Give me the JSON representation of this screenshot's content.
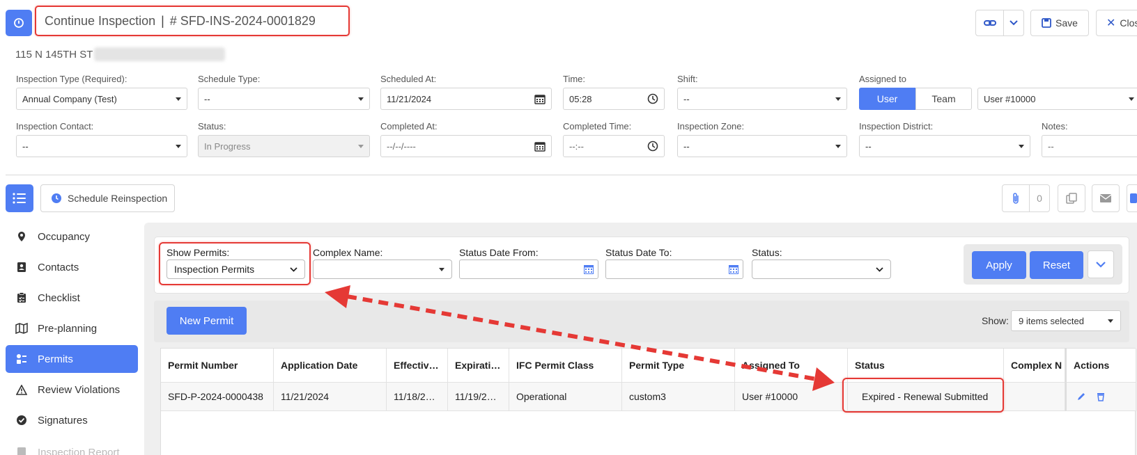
{
  "header": {
    "title": "Continue Inspection",
    "inspection_id": "# SFD-INS-2024-0001829",
    "address": "115 N 145TH ST",
    "save_label": "Save",
    "close_label": "Clos"
  },
  "form": {
    "inspection_type": {
      "label": "Inspection Type (Required):",
      "value": "Annual Company (Test)"
    },
    "schedule_type": {
      "label": "Schedule Type:",
      "value": "--"
    },
    "scheduled_at": {
      "label": "Scheduled At:",
      "value": "11/21/2024"
    },
    "time": {
      "label": "Time:",
      "value": "05:28"
    },
    "shift": {
      "label": "Shift:",
      "value": "--"
    },
    "assigned_to": {
      "label": "Assigned to",
      "user_tab": "User",
      "team_tab": "Team",
      "value": "User #10000"
    },
    "inspection_contact": {
      "label": "Inspection Contact:",
      "value": "--"
    },
    "status": {
      "label": "Status:",
      "value": "In Progress"
    },
    "completed_at": {
      "label": "Completed At:",
      "value": "--/--/----"
    },
    "completed_time": {
      "label": "Completed Time:",
      "value": "--:--"
    },
    "inspection_zone": {
      "label": "Inspection Zone:",
      "value": "--"
    },
    "inspection_district": {
      "label": "Inspection District:",
      "value": "--"
    },
    "notes": {
      "label": "Notes:",
      "value": "--"
    }
  },
  "actions_bar": {
    "schedule_reinspection": "Schedule Reinspection",
    "attachments_count": "0"
  },
  "sidebar": {
    "items": [
      {
        "label": "Occupancy",
        "icon": "map-pin-icon"
      },
      {
        "label": "Contacts",
        "icon": "contact-card-icon"
      },
      {
        "label": "Checklist",
        "icon": "clipboard-check-icon"
      },
      {
        "label": "Pre-planning",
        "icon": "map-icon"
      },
      {
        "label": "Permits",
        "icon": "permit-list-icon",
        "active": true
      },
      {
        "label": "Review Violations",
        "icon": "warning-icon"
      },
      {
        "label": "Signatures",
        "icon": "check-circle-icon"
      },
      {
        "label": "Inspection Report",
        "icon": "document-icon"
      }
    ]
  },
  "filters": {
    "show_permits": {
      "label": "Show Permits:",
      "value": "Inspection Permits"
    },
    "complex_name": {
      "label": "Complex Name:",
      "value": ""
    },
    "status_date_from": {
      "label": "Status Date From:",
      "value": ""
    },
    "status_date_to": {
      "label": "Status Date To:",
      "value": ""
    },
    "status": {
      "label": "Status:",
      "value": ""
    },
    "apply_label": "Apply",
    "reset_label": "Reset"
  },
  "toolbar": {
    "new_permit_label": "New Permit",
    "show_label": "Show:",
    "show_value": "9 items selected"
  },
  "table": {
    "columns": [
      "Permit Number",
      "Application Date",
      "Effectiv…",
      "Expirati…",
      "IFC Permit Class",
      "Permit Type",
      "Assigned To",
      "Status",
      "Complex N",
      "Actions"
    ],
    "rows": [
      [
        "SFD-P-2024-0000438",
        "11/21/2024",
        "11/18/2…",
        "11/19/2…",
        "Operational",
        "custom3",
        "User #10000",
        "Expired - Renewal Submitted",
        "",
        ""
      ]
    ]
  },
  "colors": {
    "primary": "#4f7df3",
    "highlight": "#e53935"
  }
}
